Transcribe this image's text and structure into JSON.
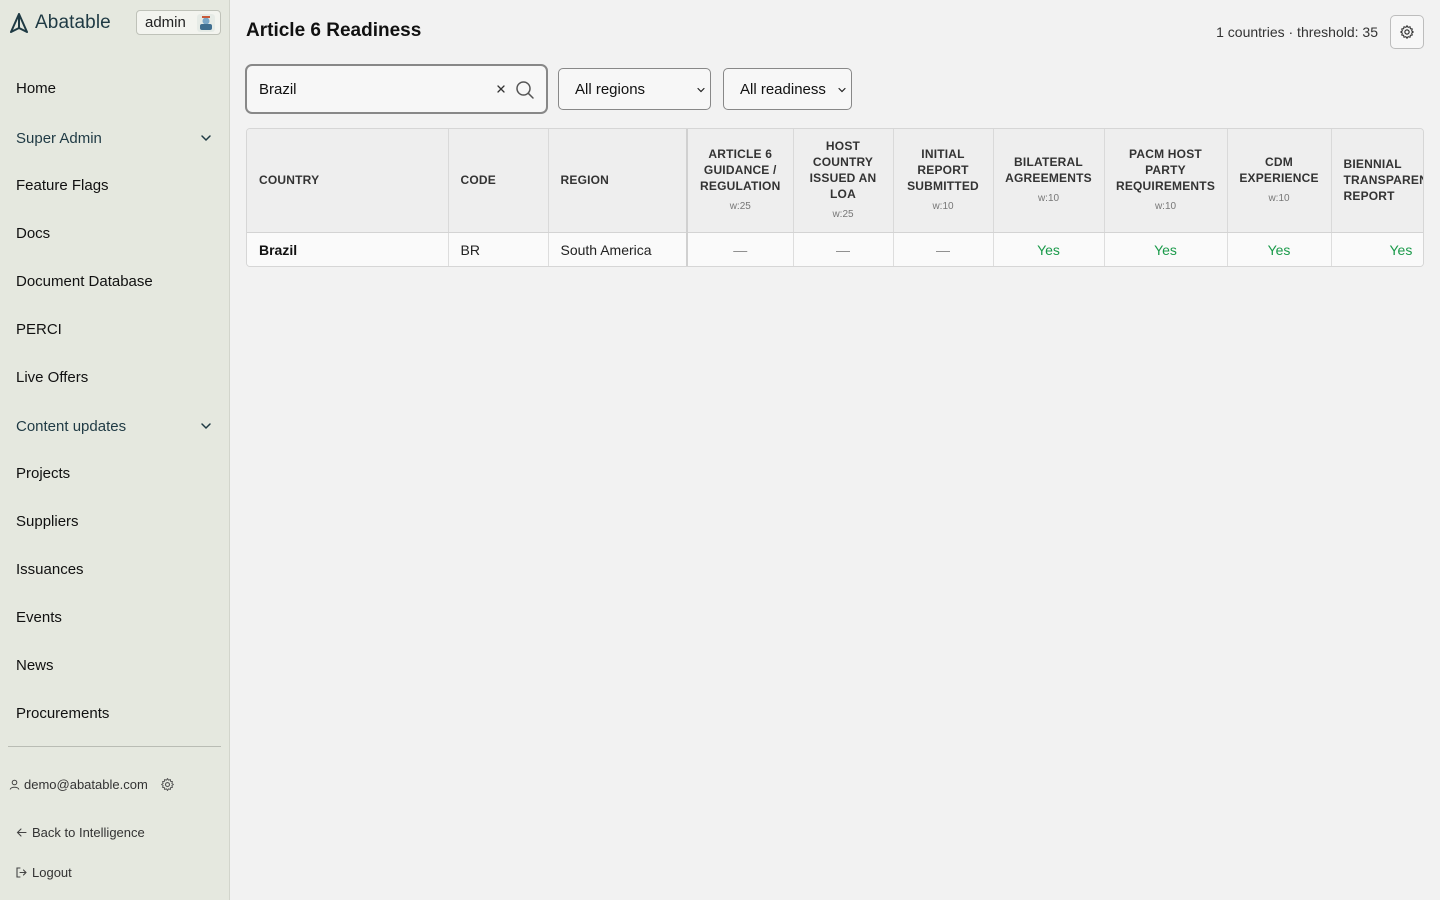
{
  "app": {
    "brand": "Abatable",
    "role_badge": "admin"
  },
  "sidebar": {
    "items": [
      {
        "label": "Home",
        "type": "link"
      },
      {
        "label": "Super Admin",
        "type": "section"
      },
      {
        "label": "Feature Flags",
        "type": "link"
      },
      {
        "label": "Docs",
        "type": "link"
      },
      {
        "label": "Document Database",
        "type": "link"
      },
      {
        "label": "PERCI",
        "type": "link"
      },
      {
        "label": "Live Offers",
        "type": "link"
      },
      {
        "label": "Content updates",
        "type": "section"
      },
      {
        "label": "Projects",
        "type": "link"
      },
      {
        "label": "Suppliers",
        "type": "link"
      },
      {
        "label": "Issuances",
        "type": "link"
      },
      {
        "label": "Events",
        "type": "link"
      },
      {
        "label": "News",
        "type": "link"
      },
      {
        "label": "Procurements",
        "type": "link"
      }
    ],
    "user_email": "demo@abatable.com",
    "back_link": "Back to Intelligence",
    "logout": "Logout"
  },
  "page": {
    "title": "Article 6 Readiness",
    "summary": "1 countries · threshold: 35"
  },
  "filters": {
    "search_value": "Brazil",
    "region_selected": "All regions",
    "readiness_selected": "All readiness"
  },
  "table": {
    "columns": [
      {
        "label": "Country",
        "weight": ""
      },
      {
        "label": "Code",
        "weight": ""
      },
      {
        "label": "Region",
        "weight": ""
      },
      {
        "label": "Article 6 Guidance / Regulation",
        "weight": "w:25"
      },
      {
        "label": "Host Country Issued an LoA",
        "weight": "w:25"
      },
      {
        "label": "Initial Report Submitted",
        "weight": "w:10"
      },
      {
        "label": "Bilateral Agreements",
        "weight": "w:10"
      },
      {
        "label": "PACM Host Party Requirements",
        "weight": "w:10"
      },
      {
        "label": "CDM Experience",
        "weight": "w:10"
      },
      {
        "label": "Biennial Transparency Report",
        "weight": ""
      }
    ],
    "rows": [
      {
        "country": "Brazil",
        "code": "BR",
        "region": "South America",
        "cells": [
          "—",
          "—",
          "—",
          "Yes",
          "Yes",
          "Yes",
          "Yes"
        ]
      }
    ]
  },
  "colors": {
    "sidebar_bg": "#e5e8df",
    "brand": "#1f3a44",
    "yes": "#1a9a4a"
  }
}
